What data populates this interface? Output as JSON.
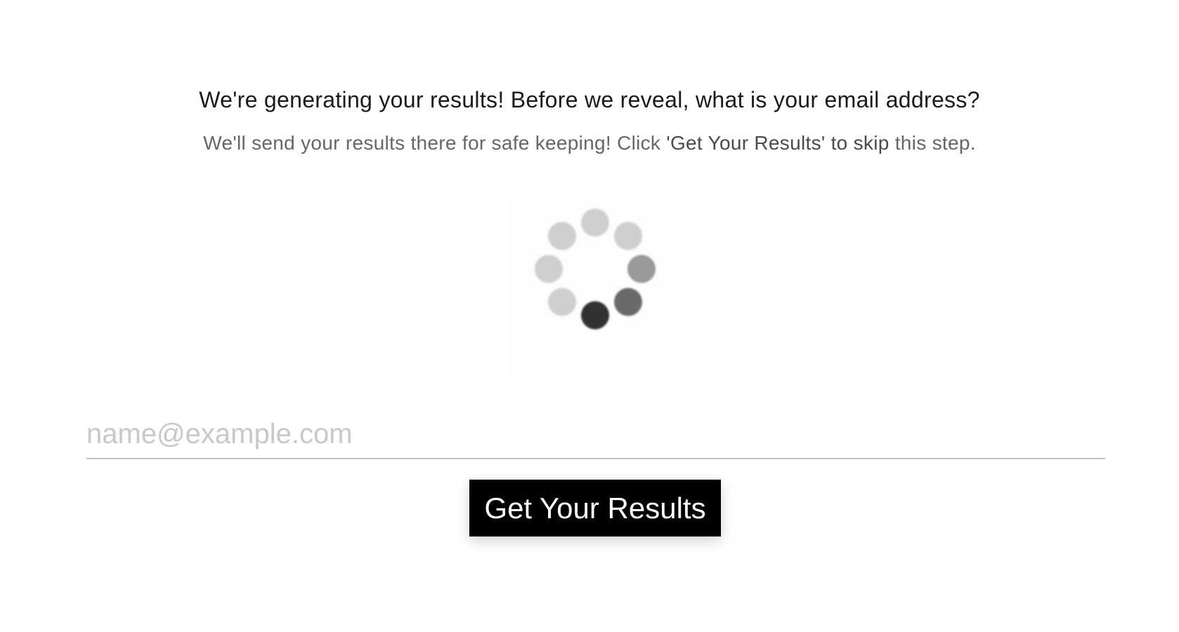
{
  "heading": "We're generating your results! Before we reveal, what is your email address?",
  "subheading": {
    "prefix": "We'll send your results there for safe keeping! Click ",
    "emphasis": "'Get Your Results' to skip",
    "suffix": " this step."
  },
  "spinner": {
    "icon": "loading-spinner-icon"
  },
  "email": {
    "value": "",
    "placeholder": "name@example.com"
  },
  "submit": {
    "label": "Get Your Results"
  }
}
